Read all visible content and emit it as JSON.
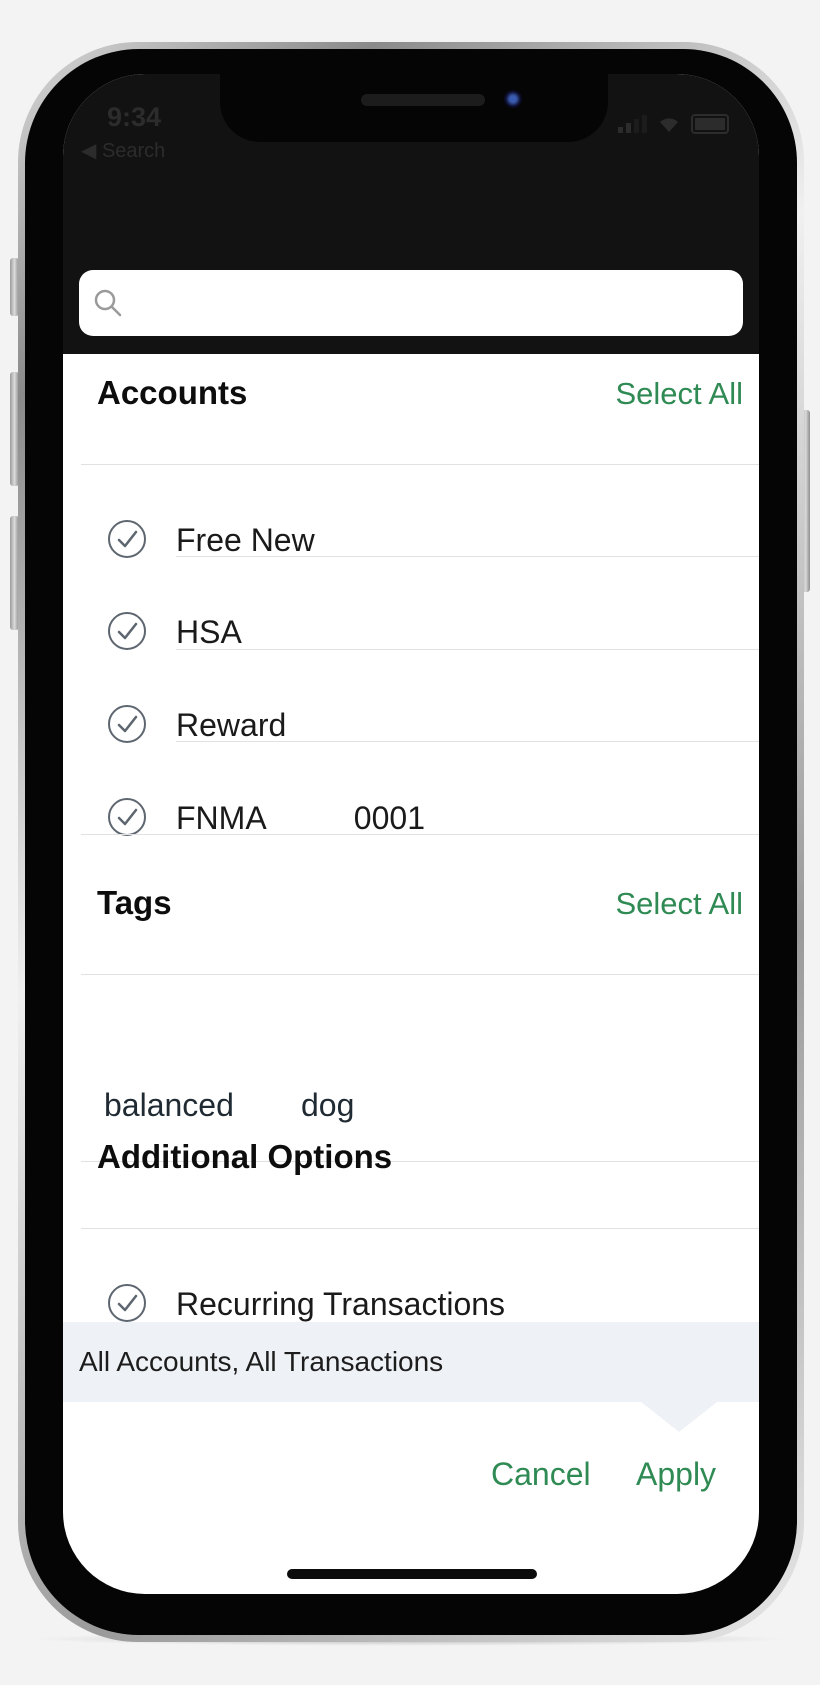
{
  "status_bar": {
    "time": "9:34",
    "back_label": "◀ Search"
  },
  "search": {
    "placeholder": ""
  },
  "accounts": {
    "title": "Accounts",
    "select_all": "Select All",
    "items": [
      {
        "label": "Free New"
      },
      {
        "label": "HSA"
      },
      {
        "label": "Reward"
      },
      {
        "label": "FNMA          0001"
      }
    ]
  },
  "tags": {
    "title": "Tags",
    "select_all": "Select All",
    "items": [
      {
        "label": "balanced"
      },
      {
        "label": "dog"
      }
    ]
  },
  "additional_options": {
    "title": "Additional Options",
    "items": [
      {
        "label": "Recurring Transactions"
      }
    ]
  },
  "summary": {
    "text": "All Accounts, All Transactions"
  },
  "actions": {
    "cancel": "Cancel",
    "apply": "Apply"
  },
  "colors": {
    "accent": "#2f8a54",
    "summary_bg": "#eef1f5"
  }
}
